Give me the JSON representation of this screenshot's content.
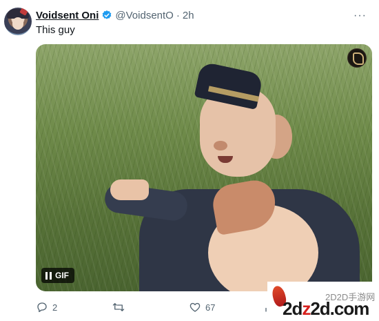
{
  "tweet": {
    "author_name": "Voidsent Oni",
    "handle": "@VoidsentO",
    "separator": "·",
    "time": "2h",
    "text": "This guy",
    "more_label": "···"
  },
  "media": {
    "badge_label": "GIF"
  },
  "actions": {
    "replies": "2",
    "likes": "67"
  },
  "watermark": {
    "site_brand_digits": "2d",
    "site_brand_z": "z",
    "site_brand_rest": "2d.com",
    "site_cn": "2D2D手游网"
  },
  "colors": {
    "verified_blue": "#1d9bf0",
    "muted_text": "#536471",
    "primary_text": "#0f1419"
  },
  "icons": {
    "verified": "verified-badge-icon",
    "more": "more-icon",
    "pause": "pause-icon",
    "reply": "reply-icon",
    "retweet": "retweet-icon",
    "like": "like-icon",
    "views": "views-icon"
  }
}
